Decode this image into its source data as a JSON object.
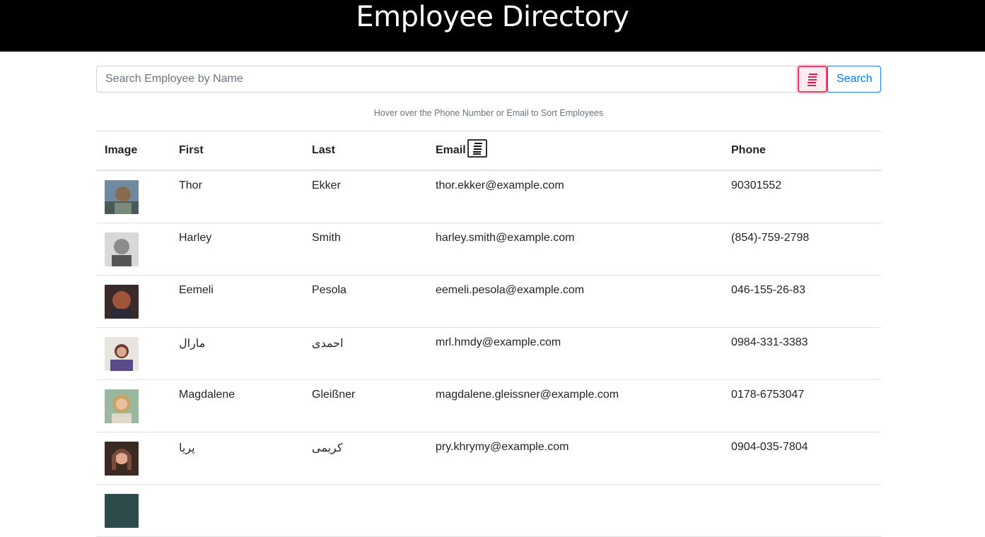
{
  "header": {
    "title": "Employee Directory"
  },
  "search": {
    "placeholder": "Search Employee by Name",
    "button_label": "Search",
    "sort_icon": "sort-list-icon"
  },
  "hint": "Hover over the Phone Number or Email to Sort Employees",
  "table": {
    "columns": [
      "Image",
      "First",
      "Last",
      "Email",
      "Phone"
    ],
    "rows": [
      {
        "first": "Thor",
        "last": "Ekker",
        "email": "thor.ekker@example.com",
        "phone": "90301552",
        "avatar_color": "#8a6a4f"
      },
      {
        "first": "Harley",
        "last": "Smith",
        "email": "harley.smith@example.com",
        "phone": "(854)-759-2798",
        "avatar_color": "#8c8c8c"
      },
      {
        "first": "Eemeli",
        "last": "Pesola",
        "email": "eemeli.pesola@example.com",
        "phone": "046-155-26-83",
        "avatar_color": "#a0553a"
      },
      {
        "first": "مارال",
        "last": "احمدی",
        "email": "mrl.hmdy@example.com",
        "phone": "0984-331-3383",
        "avatar_color": "#5a4a8a"
      },
      {
        "first": "Magdalene",
        "last": "Gleißner",
        "email": "magdalene.gleissner@example.com",
        "phone": "0178-6753047",
        "avatar_color": "#c9a46a"
      },
      {
        "first": "پریا",
        "last": "کریمی",
        "email": "pry.khrymy@example.com",
        "phone": "0904-035-7804",
        "avatar_color": "#7a4a3a"
      },
      {
        "first": "",
        "last": "",
        "email": "",
        "phone": "",
        "avatar_color": "#2f4a4a"
      }
    ]
  }
}
